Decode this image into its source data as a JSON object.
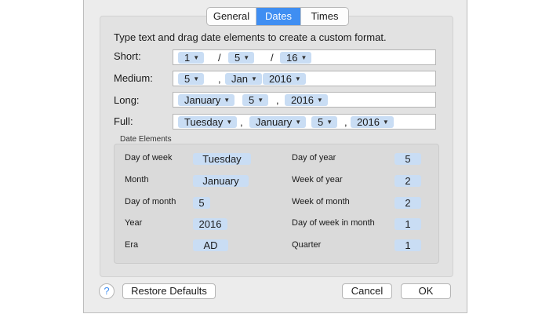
{
  "tabs": [
    {
      "label": "General",
      "active": false
    },
    {
      "label": "Dates",
      "active": true
    },
    {
      "label": "Times",
      "active": false
    }
  ],
  "instruction": "Type text and drag date elements to create a custom format.",
  "formats": {
    "short": {
      "label": "Short:",
      "tokens": [
        "1",
        "5",
        "16"
      ],
      "separators": [
        "/",
        "/"
      ]
    },
    "medium": {
      "label": "Medium:",
      "tokens": [
        "5",
        "Jan",
        "2016"
      ],
      "separators": [
        ",",
        ""
      ]
    },
    "long": {
      "label": "Long:",
      "tokens": [
        "January",
        "5",
        "2016"
      ],
      "separators": [
        "",
        ","
      ]
    },
    "full": {
      "label": "Full:",
      "tokens": [
        "Tuesday",
        "January",
        "5",
        "2016"
      ],
      "separators": [
        ",",
        "",
        ","
      ]
    }
  },
  "date_elements": {
    "title": "Date Elements",
    "left": [
      {
        "label": "Day of week",
        "value": "Tuesday"
      },
      {
        "label": "Month",
        "value": "January"
      },
      {
        "label": "Day of month",
        "value": "5"
      },
      {
        "label": "Year",
        "value": "2016"
      },
      {
        "label": "Era",
        "value": "AD"
      }
    ],
    "right": [
      {
        "label": "Day of year",
        "value": "5"
      },
      {
        "label": "Week of year",
        "value": "2"
      },
      {
        "label": "Week of month",
        "value": "2"
      },
      {
        "label": "Day of week in month",
        "value": "1"
      },
      {
        "label": "Quarter",
        "value": "1"
      }
    ]
  },
  "buttons": {
    "help": "?",
    "restore": "Restore Defaults",
    "cancel": "Cancel",
    "ok": "OK"
  },
  "icons": {
    "dropdown": "chevron-down-icon",
    "help": "help-icon"
  },
  "colors": {
    "accent": "#3f8ef2",
    "token_bg": "#c9ddf4",
    "dialog_bg": "#ececec"
  }
}
